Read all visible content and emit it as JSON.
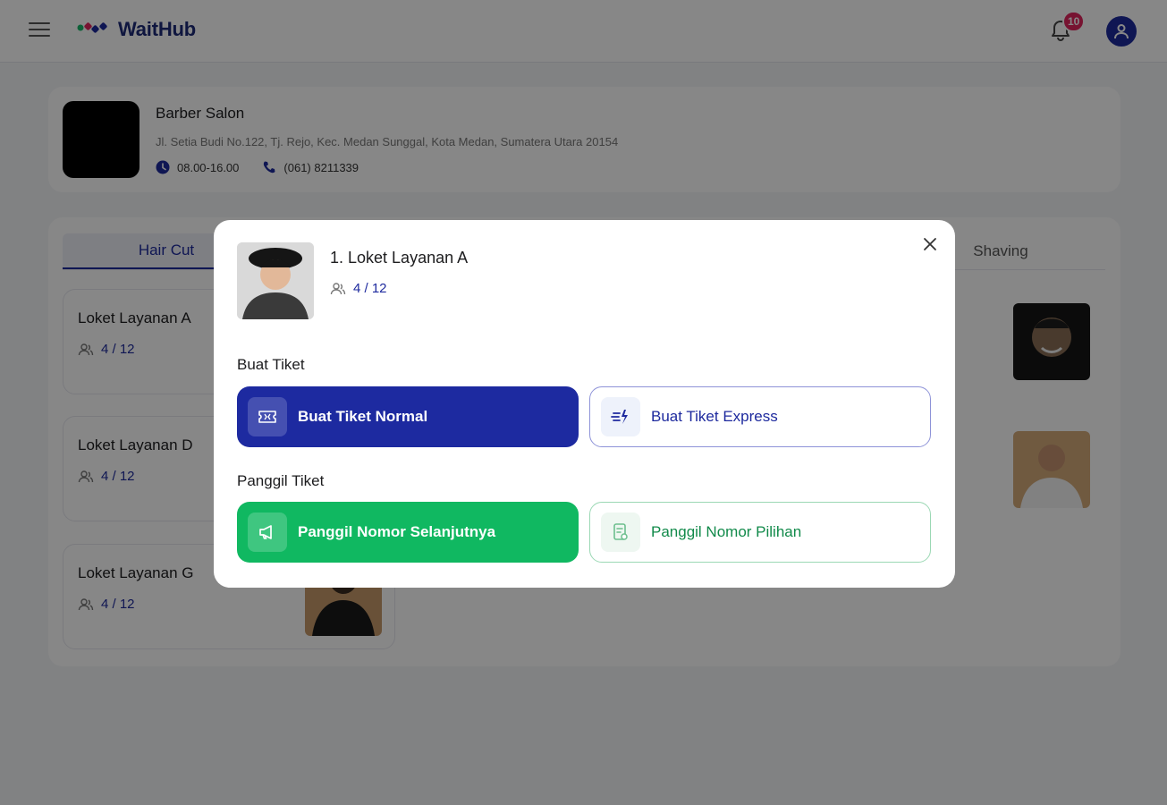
{
  "app": {
    "name": "WaitHub",
    "notification_count": "10"
  },
  "business": {
    "name": "Barber Salon",
    "address": "Jl. Setia Budi No.122, Tj. Rejo, Kec. Medan Sunggal, Kota Medan, Sumatera Utara 20154",
    "hours": "08.00-16.00",
    "phone": "(061) 8211339"
  },
  "tabs": [
    {
      "label": "Hair Cut",
      "active": true
    },
    {
      "label": "Shaving",
      "active": false
    }
  ],
  "queues": [
    {
      "name": "Loket Layanan A",
      "count": "4 / 12"
    },
    {
      "name": "Loket Layanan D",
      "count": "4 / 12"
    },
    {
      "name": "Loket Layanan G",
      "count": "4 / 12"
    }
  ],
  "modal": {
    "title": "1. Loket Layanan A",
    "count": "4 / 12",
    "create_section": "Buat Tiket",
    "create_normal": "Buat Tiket Normal",
    "create_express": "Buat Tiket Express",
    "call_section": "Panggil Tiket",
    "call_next": "Panggil Nomor Selanjutnya",
    "call_pick": "Panggil Nomor Pilihan"
  },
  "colors": {
    "primary": "#1d2aa0",
    "success": "#10b861",
    "badge": "#e0245e"
  }
}
